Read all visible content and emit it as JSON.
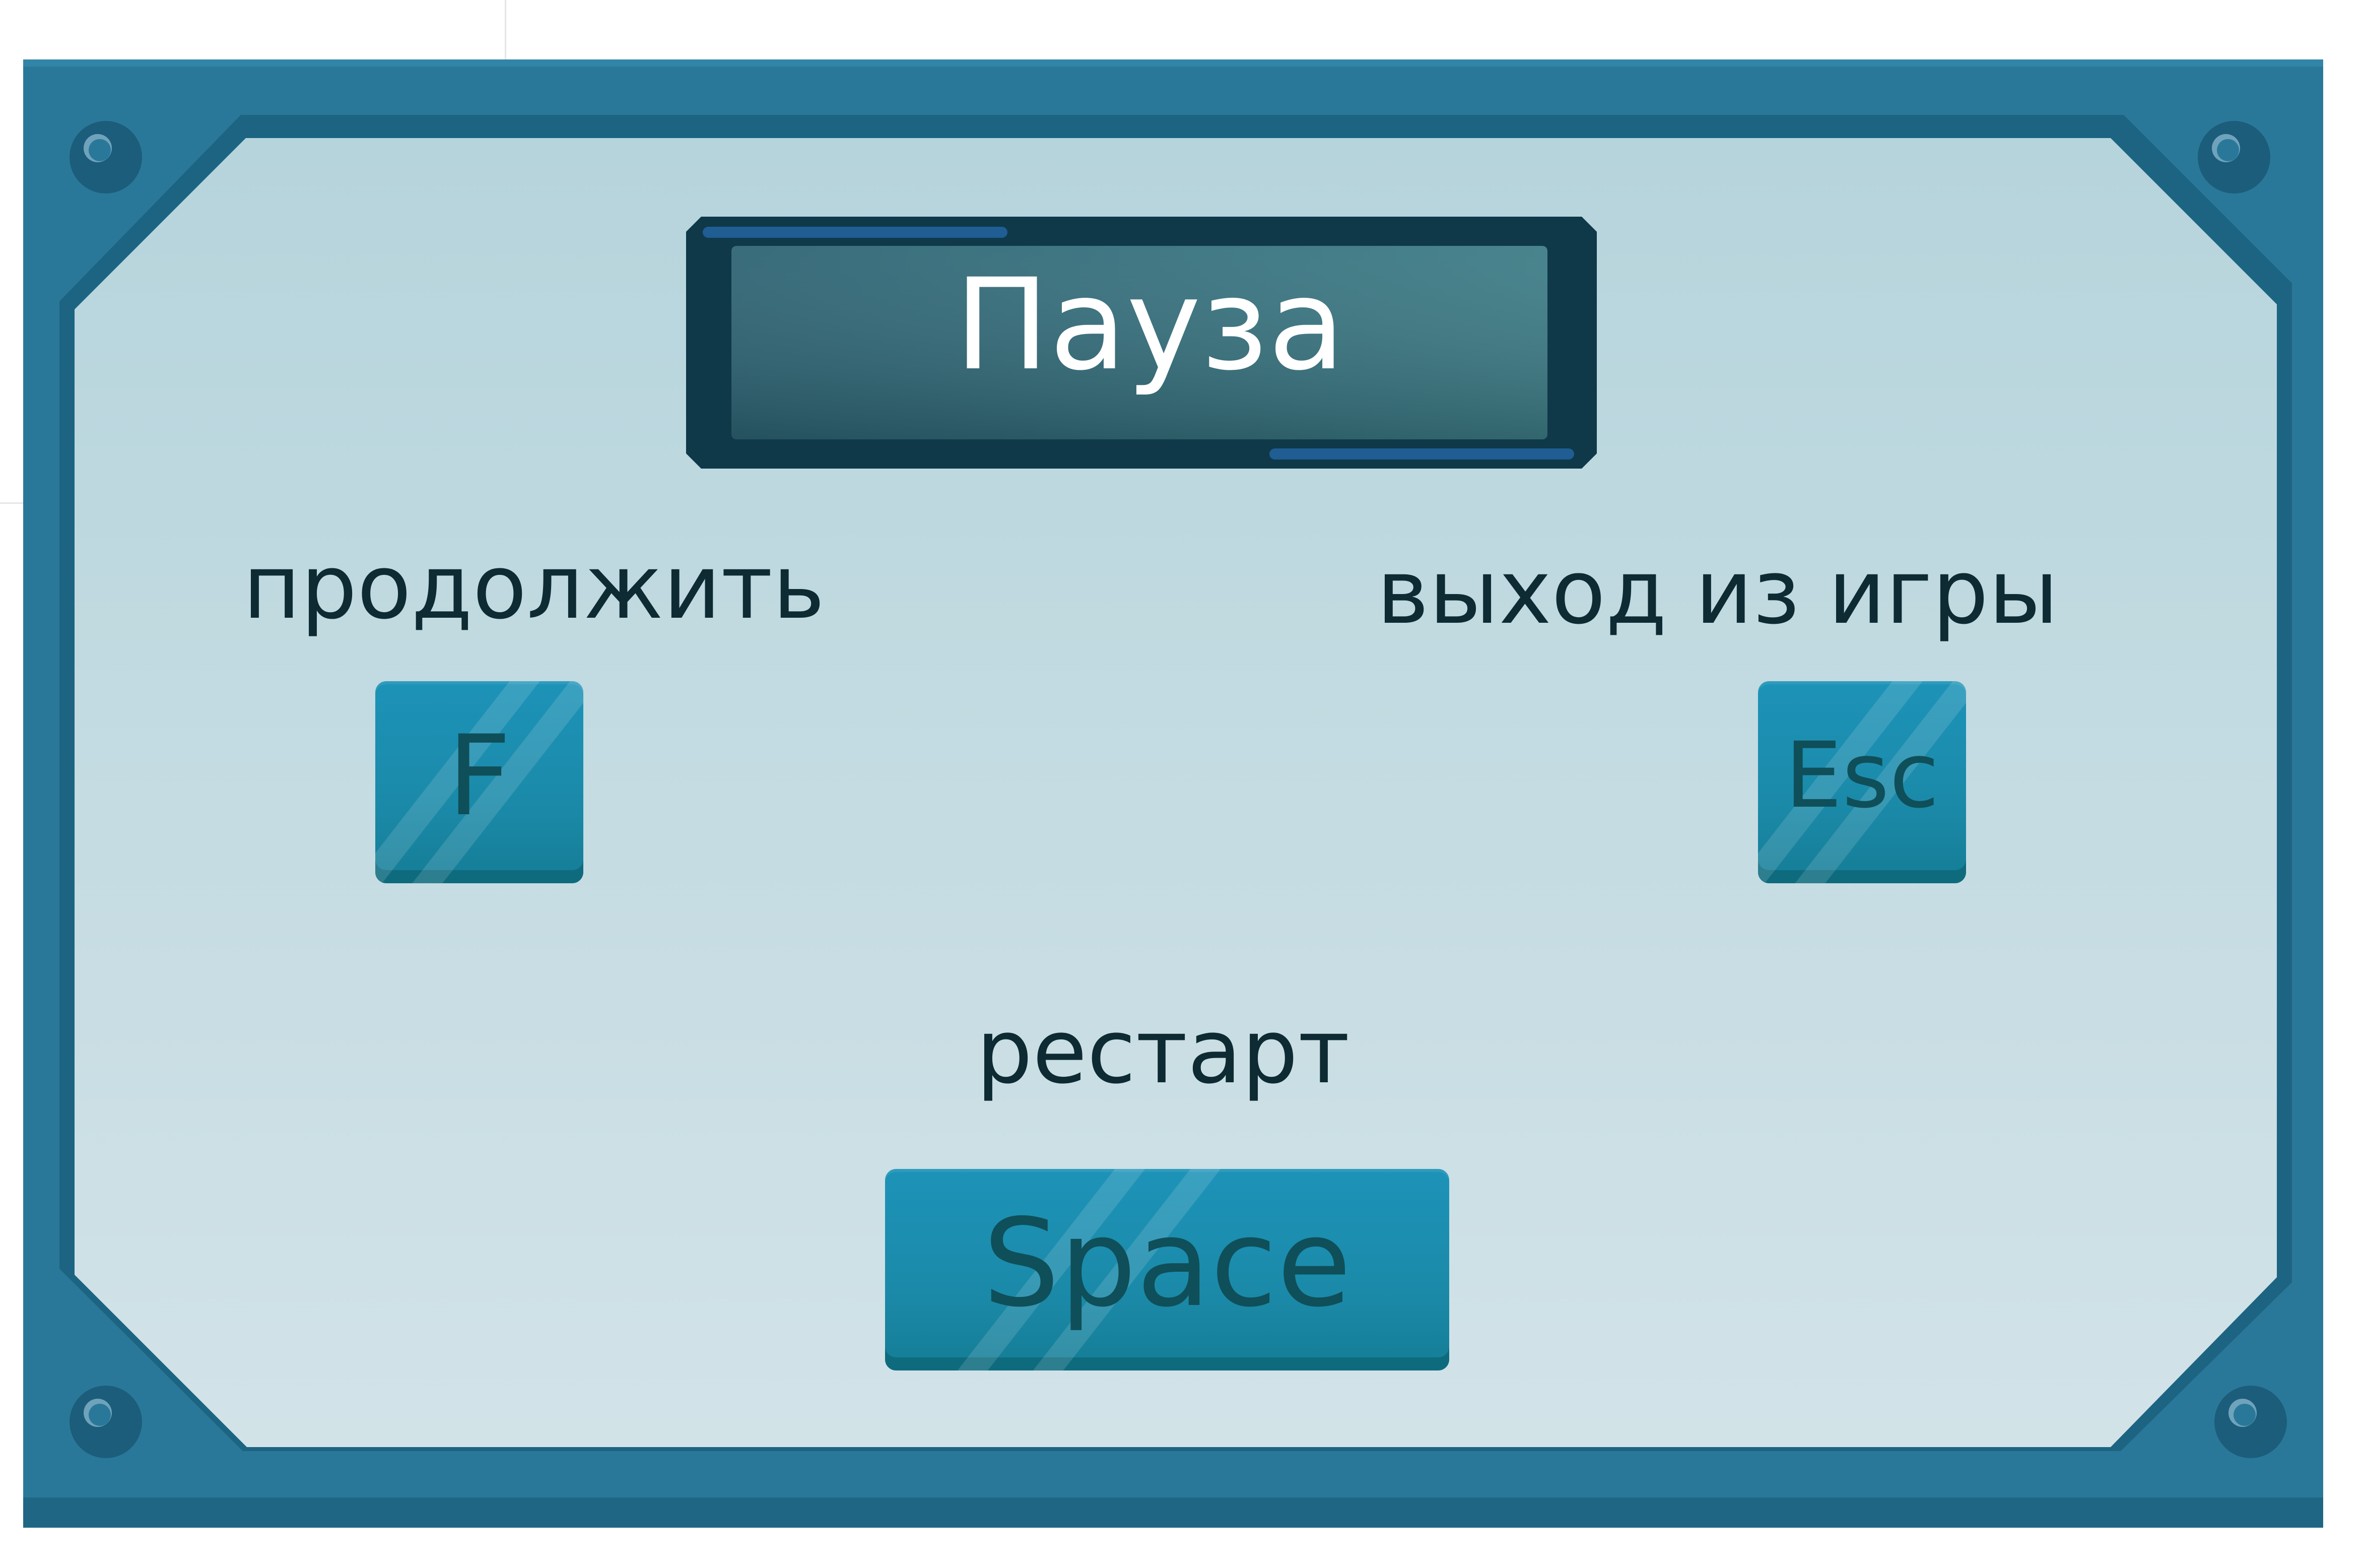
{
  "pause_menu": {
    "title": "Пауза",
    "actions": {
      "continue": {
        "label": "продолжить",
        "key": "F"
      },
      "exit": {
        "label": "выход из игры",
        "key": "Esc"
      },
      "restart": {
        "label": "рестарт",
        "key": "Space"
      }
    }
  },
  "colors": {
    "frame": "#2a7899",
    "frame_dark": "#1a5f7d",
    "panel": "#c5dce3",
    "title_bar": "#0f3949",
    "key": "#1d93b8",
    "key_text": "#0f4f59"
  }
}
